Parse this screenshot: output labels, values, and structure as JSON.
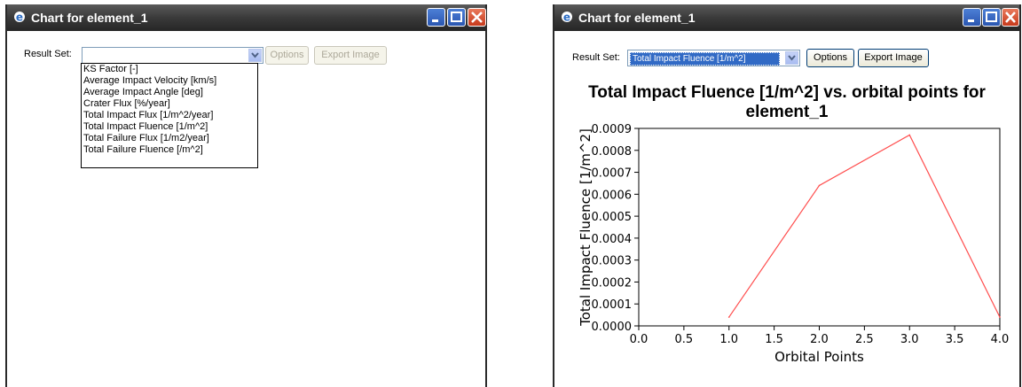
{
  "left_window": {
    "title": "Chart for element_1",
    "result_set_label": "Result Set:",
    "selected_value": "",
    "options_button": "Options",
    "export_button": "Export Image",
    "dropdown_options": [
      "KS Factor [-]",
      "Average Impact Velocity [km/s]",
      "Average Impact Angle [deg]",
      "Crater Flux [%/year]",
      "Total Impact Flux [1/m^2/year]",
      "Total Impact Fluence [1/m^2]",
      "Total Failure Flux [1/m2/year]",
      "Total Failure Fluence [/m^2]"
    ]
  },
  "right_window": {
    "title": "Chart for element_1",
    "result_set_label": "Result Set:",
    "selected_value": "Total Impact Fluence [1/m^2]",
    "options_button": "Options",
    "export_button": "Export Image"
  },
  "chart_data": {
    "type": "line",
    "title_line1": "Total Impact Fluence [1/m^2] vs. orbital points for",
    "title_line2": "element_1",
    "xlabel": "Orbital Points",
    "ylabel": "Total Impact Fluence [1/m^2]",
    "xlim": [
      0.0,
      4.0
    ],
    "ylim": [
      0.0,
      0.0009
    ],
    "x_ticks": [
      "0.0",
      "0.5",
      "1.0",
      "1.5",
      "2.0",
      "2.5",
      "3.0",
      "3.5",
      "4.0"
    ],
    "y_ticks": [
      "0.0000",
      "0.0001",
      "0.0002",
      "0.0003",
      "0.0004",
      "0.0005",
      "0.0006",
      "0.0007",
      "0.0008",
      "0.0009"
    ],
    "x": [
      1,
      2,
      3,
      4
    ],
    "y": [
      4e-05,
      0.00064,
      0.00087,
      4e-05
    ],
    "line_color": "#ff4d4d",
    "grid": false
  },
  "colors": {
    "title_bar": "#3a3a3a",
    "selection": "#316ac5",
    "close_button": "#d04a2c"
  }
}
